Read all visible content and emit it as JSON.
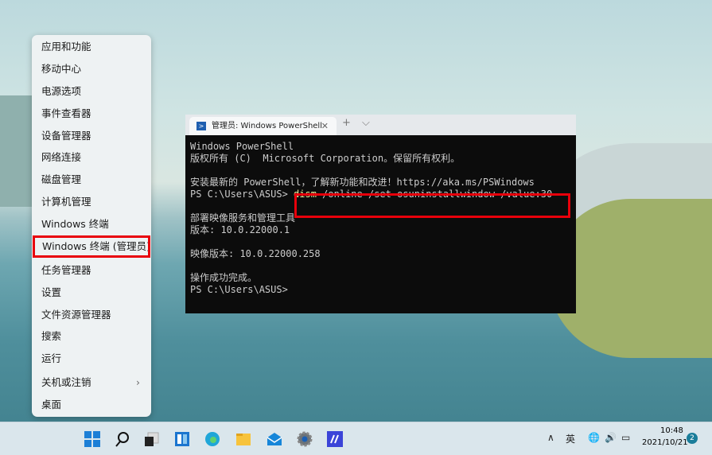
{
  "menu": {
    "items": [
      "应用和功能",
      "移动中心",
      "电源选项",
      "事件查看器",
      "设备管理器",
      "网络连接",
      "磁盘管理",
      "计算机管理",
      "Windows 终端",
      "Windows 终端 (管理员)",
      "任务管理器",
      "设置",
      "文件资源管理器",
      "搜索",
      "运行",
      "关机或注销",
      "桌面"
    ],
    "highlighted_index": 9
  },
  "terminal": {
    "tab_title": "管理员: Windows PowerShell",
    "new_tab": "+",
    "dropdown": "⌵",
    "close": "✕",
    "lines": [
      "Windows PowerShell",
      "版权所有 (C)  Microsoft Corporation。保留所有权利。",
      "",
      "安装最新的 PowerShell，了解新功能和改进！https://aka.ms/PSWindows",
      "",
      "",
      "部署映像服务和管理工具",
      "版本: 10.0.22000.1",
      "",
      "映像版本: 10.0.22000.258",
      "",
      "操作成功完成。",
      "PS C:\\Users\\ASUS>"
    ],
    "prompt": "PS C:\\Users\\ASUS> ",
    "command_name": "dism",
    "command_args": " /online /set-osuninstallwindow /value:30"
  },
  "taskbar": {
    "tray_chevron": "∧",
    "ime": "英",
    "time": "10:48",
    "date": "2021/10/21",
    "notifications": "2"
  },
  "colors": {
    "highlight": "#e8000b",
    "terminal_bg": "#0c0c0c"
  }
}
